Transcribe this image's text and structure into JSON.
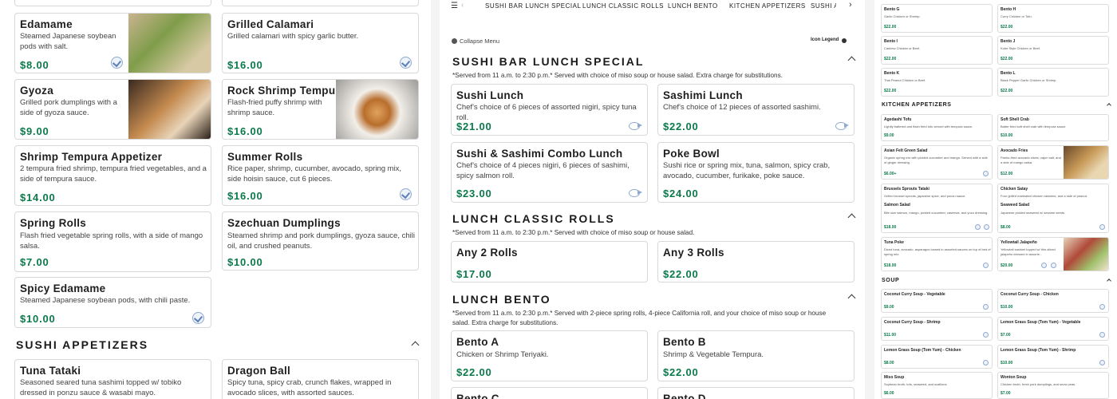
{
  "left": {
    "col1": [
      {
        "name": "Edamame",
        "desc": "Steamed Japanese soybean pods with salt.",
        "price": "$8.00"
      },
      {
        "name": "Gyoza",
        "desc": "Grilled pork dumplings with a side of gyoza sauce.",
        "price": "$9.00"
      },
      {
        "name": "Shrimp Tempura Appetizer",
        "desc": "2 tempura fried shrimp, tempura fried vegetables, and a side of tempura sauce.",
        "price": "$14.00"
      },
      {
        "name": "Spring Rolls",
        "desc": "Flash fried vegetable spring rolls, with a side of mango salsa.",
        "price": "$7.00"
      },
      {
        "name": "Spicy Edamame",
        "desc": "Steamed Japanese soybean pods, with chili paste.",
        "price": "$10.00"
      }
    ],
    "col2": [
      {
        "name": "Grilled Calamari",
        "desc": "Grilled calamari with spicy garlic butter.",
        "price": "$16.00"
      },
      {
        "name": "Rock Shrimp Tempura",
        "desc": "Flash-fried puffy shrimp with shrimp sauce.",
        "price": "$16.00"
      },
      {
        "name": "Summer Rolls",
        "desc": "Rice paper, shrimp, cucumber, avocado, spring mix, side hoisin sauce, cut 6 pieces.",
        "price": "$16.00"
      },
      {
        "name": "Szechuan Dumplings",
        "desc": "Steamed shrimp and pork dumplings, gyoza sauce, chili oil, and crushed peanuts.",
        "price": "$10.00"
      }
    ],
    "section_title": "SUSHI APPETIZERS",
    "sushi_apps": [
      {
        "name": "Tuna Tataki",
        "desc": "Seasoned seared tuna sashimi topped w/ tobiko dressed in ponzu sauce & wasabi mayo."
      },
      {
        "name": "Dragon Ball",
        "desc": "Spicy tuna, spicy crab, crunch flakes, wrapped in avocado slices, with assorted sauces."
      }
    ]
  },
  "mid": {
    "tabs": [
      "SUSHI BAR LUNCH SPECIAL",
      "LUNCH CLASSIC ROLLS",
      "LUNCH BENTO",
      "KITCHEN APPETIZERS",
      "SUSHI A"
    ],
    "collapse": "Collapse Menu",
    "legend": "Icon Legend",
    "s1": {
      "title": "SUSHI BAR LUNCH SPECIAL",
      "note": "*Served from 11 a.m. to 2:30 p.m.* Served with choice of miso soup or house salad. Extra charge for substitutions.",
      "items": [
        {
          "name": "Sushi Lunch",
          "desc": "Chef's choice of 6 pieces of assorted nigiri, spicy tuna roll.",
          "price": "$21.00"
        },
        {
          "name": "Sashimi Lunch",
          "desc": "Chef's choice of 12 pieces of assorted sashimi.",
          "price": "$22.00"
        },
        {
          "name": "Sushi & Sashimi Combo Lunch",
          "desc": "Chef's choice of 4 pieces nigiri, 6 pieces of sashimi, spicy salmon roll.",
          "price": "$23.00"
        },
        {
          "name": "Poke Bowl",
          "desc": "Sushi rice or spring mix, tuna, salmon, spicy crab, avocado, cucumber, furikake, poke sauce.",
          "price": "$24.00"
        }
      ]
    },
    "s2": {
      "title": "LUNCH CLASSIC ROLLS",
      "note": "*Served from 11 a.m. to 2:30 p.m.* Served with choice of miso soup or house salad.",
      "items": [
        {
          "name": "Any 2 Rolls",
          "price": "$17.00"
        },
        {
          "name": "Any 3 Rolls",
          "price": "$22.00"
        }
      ]
    },
    "s3": {
      "title": "LUNCH BENTO",
      "note": "*Served from 11 a.m. to 2:30 p.m.* Served with 2-piece spring rolls, 4-piece California roll, and your choice of miso soup or house salad. Extra charge for substitutions.",
      "items": [
        {
          "name": "Bento A",
          "desc": "Chicken or Shrimp Teriyaki.",
          "price": "$22.00"
        },
        {
          "name": "Bento B",
          "desc": "Shrimp & Vegetable Tempura.",
          "price": "$22.00"
        },
        {
          "name": "Bento C"
        },
        {
          "name": "Bento D"
        }
      ]
    }
  },
  "right": {
    "bento": [
      {
        "name": "Bento G",
        "desc": "Garlic Chicken or Shrimp.",
        "price": "$22.00"
      },
      {
        "name": "Bento H",
        "desc": "Curry Chicken or Tofu.",
        "price": "$22.00"
      },
      {
        "name": "Bento I",
        "desc": "Cashew Chicken or Beef.",
        "price": "$22.00"
      },
      {
        "name": "Bento J",
        "desc": "Kobe Style Chicken or Beef.",
        "price": "$22.00"
      },
      {
        "name": "Bento K",
        "desc": "Thai Peanut Chicken or Beef.",
        "price": "$22.00"
      },
      {
        "name": "Bento L",
        "desc": "Black Pepper Garlic Chicken or Shrimp.",
        "price": "$22.00"
      }
    ],
    "kitchen_title": "KITCHEN APPETIZERS",
    "kitchen": [
      {
        "name": "Agedashi Tofu",
        "desc": "Lightly battered and flash fried tofu served with tempura sauce.",
        "price": "$9.00"
      },
      {
        "name": "Soft Shell Crab",
        "desc": "Batter fried soft shell crab with tempura sauce.",
        "price": "$10.00"
      },
      {
        "name": "Asian Felt Green Salad",
        "desc": "Organic spring mix with pickled cucumber and mango. Served with a side of ginger dressing.",
        "price": "$6.00+"
      },
      {
        "name": "Avocado Fries",
        "desc": "Panko-fried avocado slices, cajun salt, and a side of mango salsa.",
        "price": "$12.00"
      },
      {
        "name": "Brussels Sprouts Tataki",
        "desc": "Grilled brussel sprouts, japanese spice, and ponzu sauce.",
        "price": ""
      },
      {
        "name": "Chicken Satay",
        "desc": "Four grilled marinated chicken skewers, and a side of peanut.",
        "price": ""
      },
      {
        "name": "Salmon Salad",
        "desc": "Bite size salmon, mango, pickled cucumber, cashews, and yuzu dressing.",
        "price": "$18.00"
      },
      {
        "name": "Seaweed Salad",
        "desc": "Japanese pickled seaweed w/ sesame seeds.",
        "price": "$8.00"
      },
      {
        "name": "Tuna Poke",
        "desc": "Diced tuna, avocado, asparagus tossed in assorted sauces on top of bed of spring mix.",
        "price": "$18.00"
      },
      {
        "name": "Yellowtail Jalapeño",
        "desc": "Yellowtail sashimi topped w/ thin-sliced jalapeño dressed in assorte...",
        "price": "$20.00"
      }
    ],
    "soup_title": "SOUP",
    "soup": [
      {
        "name": "Coconut Curry Soup - Vegetable",
        "price": "$9.00"
      },
      {
        "name": "Coconut Curry Soup - Chicken",
        "price": "$10.00"
      },
      {
        "name": "Coconut Curry Soup - Shrimp",
        "price": "$11.00"
      },
      {
        "name": "Lemon Grass Soup (Tom Yum) - Vegetable",
        "price": "$7.00"
      },
      {
        "name": "Lemon Grass Soup (Tom Yum) - Chicken",
        "price": "$8.00"
      },
      {
        "name": "Lemon Grass Soup (Tom Yum) - Shrimp",
        "price": "$10.00"
      },
      {
        "name": "Miso Soup",
        "desc": "Soybean broth, tofu, seaweed, and scallions.",
        "price": "$6.00"
      },
      {
        "name": "Wonton Soup",
        "desc": "Chicken broth, fresh pork dumplings, and snow peas.",
        "price": "$7.00"
      }
    ]
  },
  "colors": {
    "price": "#0b7a4b",
    "icon": "#8fa9cf",
    "bg_gap": "#f4f4f4"
  }
}
